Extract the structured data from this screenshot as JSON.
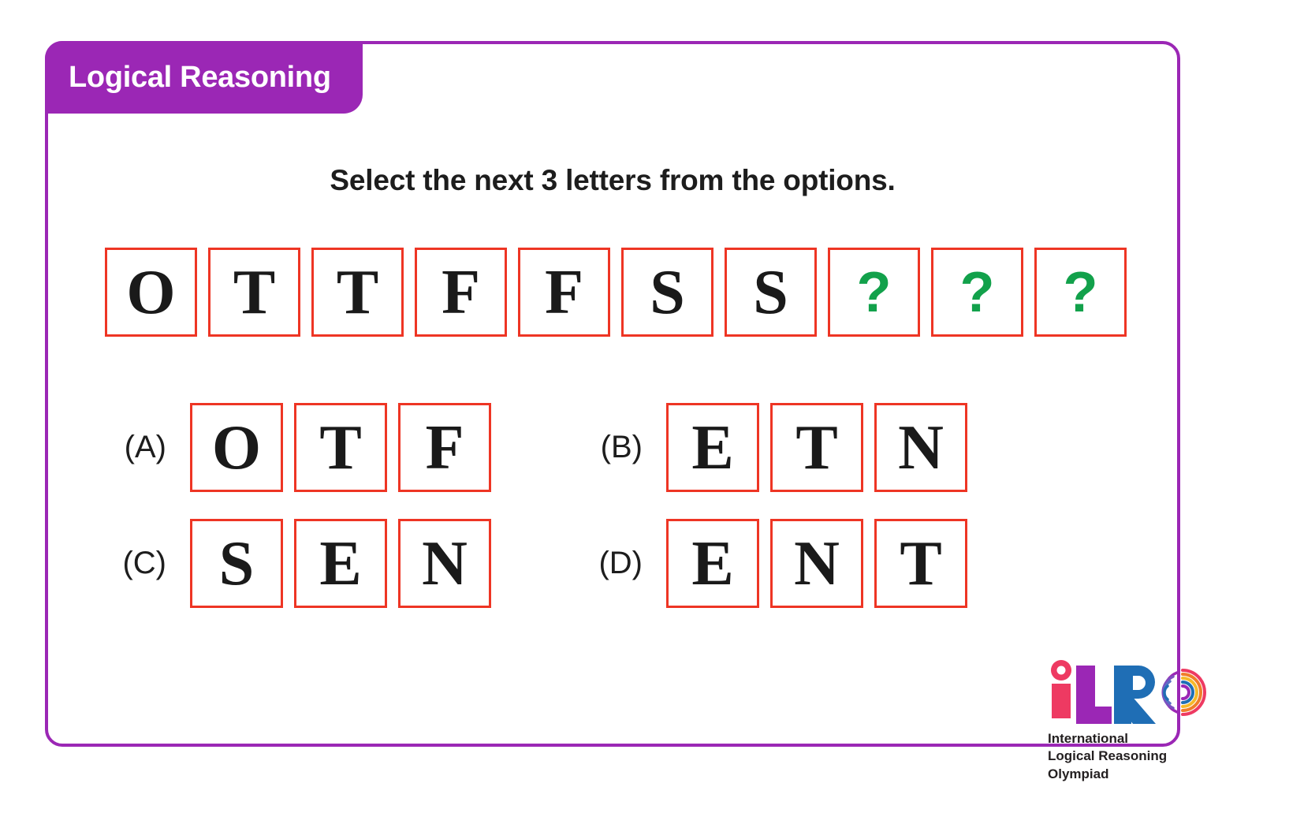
{
  "header": {
    "badge_label": "Logical Reasoning",
    "badge_color": "#9b27b5",
    "card_border_color": "#9b27b5"
  },
  "question": {
    "prompt": "Select the next 3 letters from the options.",
    "sequence": [
      {
        "value": "O",
        "is_unknown": false
      },
      {
        "value": "T",
        "is_unknown": false
      },
      {
        "value": "T",
        "is_unknown": false
      },
      {
        "value": "F",
        "is_unknown": false
      },
      {
        "value": "F",
        "is_unknown": false
      },
      {
        "value": "S",
        "is_unknown": false
      },
      {
        "value": "S",
        "is_unknown": false
      },
      {
        "value": "?",
        "is_unknown": true
      },
      {
        "value": "?",
        "is_unknown": true
      },
      {
        "value": "?",
        "is_unknown": true
      }
    ],
    "cell_border_color": "#ee3524",
    "letter_color": "#1a1a1a",
    "unknown_color": "#12a14b"
  },
  "options": [
    {
      "label": "(A)",
      "letters": [
        "O",
        "T",
        "F"
      ]
    },
    {
      "label": "(B)",
      "letters": [
        "E",
        "T",
        "N"
      ]
    },
    {
      "label": "(C)",
      "letters": [
        "S",
        "E",
        "N"
      ]
    },
    {
      "label": "(D)",
      "letters": [
        "E",
        "N",
        "T"
      ]
    }
  ],
  "logo": {
    "letter_i": "i",
    "letter_l": "L",
    "letter_r": "R",
    "tagline_line1": "International",
    "tagline_line2": "Logical Reasoning",
    "tagline_line3": "Olympiad",
    "color_i": "#ee3a62",
    "color_l": "#9b27b5",
    "color_r": "#1f6eb5"
  }
}
